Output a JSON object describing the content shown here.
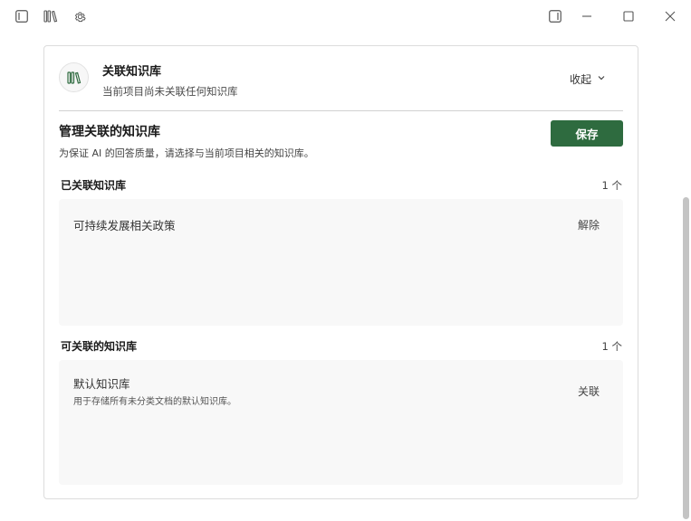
{
  "titlebar": {
    "left_icons": [
      "sidebar-toggle-icon",
      "library-icon",
      "settings-gear-icon"
    ],
    "right_icons": [
      "panel-toggle-icon",
      "minimize-icon",
      "maximize-icon",
      "close-icon"
    ]
  },
  "header": {
    "title": "关联知识库",
    "subtitle": "当前项目尚未关联任何知识库",
    "collapse_label": "收起",
    "icon": "library-icon"
  },
  "manage": {
    "title": "管理关联的知识库",
    "description": "为保证 AI 的回答质量，请选择与当前项目相关的知识库。",
    "save_label": "保存"
  },
  "linked": {
    "title": "已关联知识库",
    "count": "1 个",
    "items": [
      {
        "name": "可持续发展相关政策",
        "action": "解除"
      }
    ]
  },
  "available": {
    "title": "可关联的知识库",
    "count": "1 个",
    "items": [
      {
        "name": "默认知识库",
        "description": "用于存储所有未分类文档的默认知识库。",
        "action": "关联"
      }
    ]
  },
  "colors": {
    "accent": "#2e6b3f",
    "list_bg": "#f8f8f8",
    "border": "#dcdcdc"
  }
}
